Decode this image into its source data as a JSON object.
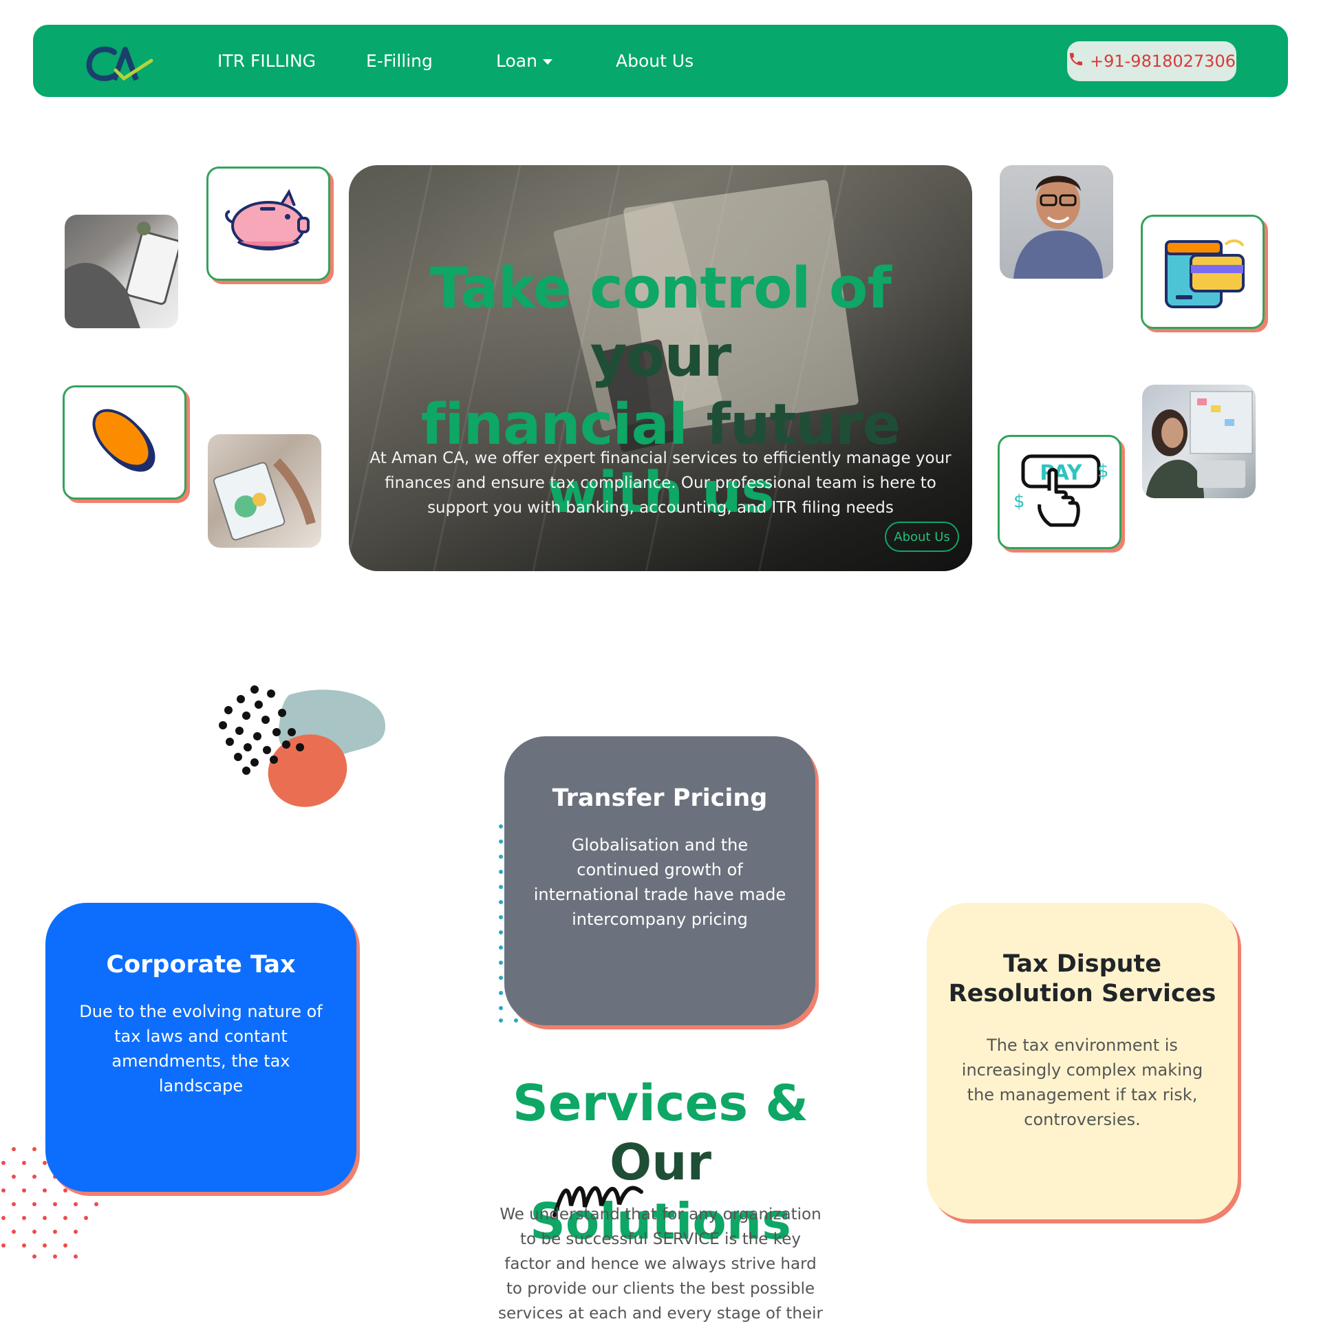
{
  "colors": {
    "brand_green": "#06a86b",
    "accent_coral": "#f0806e",
    "hero_title_green": "#0ea765",
    "hero_title_dark": "#1f4e36",
    "card_gray": "#6c727d",
    "card_blue": "#0d6efd",
    "card_cream": "#fff3cd"
  },
  "nav": {
    "logo_alt": "CA",
    "links": [
      {
        "label": "ITR FILLING"
      },
      {
        "label": "E-Filling"
      },
      {
        "label": "Loan"
      },
      {
        "label": "About Us"
      }
    ],
    "phone": "+91-9818027306",
    "phone_icon": "phone-icon"
  },
  "hero": {
    "title_part1": "Take control of ",
    "title_part2": "your",
    "title_part3": "financial ",
    "title_part4": "future",
    "title_part5": "with us",
    "description": "At Aman CA, we offer expert financial services to efficiently manage your finances and ensure tax compliance. Our professional team is here to support you with banking, accounting, and ITR filing needs",
    "button_label": "About Us"
  },
  "tiles": {
    "left_icons": [
      "piggy-bank-icon",
      "coin-icon"
    ],
    "right_icons": [
      "wallet-card-icon",
      "pay-click-icon"
    ],
    "pay_text": "PAY"
  },
  "services": {
    "cards": [
      {
        "title": "Transfer Pricing",
        "text": "Globalisation and the continued growth of international trade have made intercompany pricing"
      },
      {
        "title": "Corporate Tax",
        "text": "Due to the evolving nature of tax laws and contant amendments, the tax landscape"
      },
      {
        "title": "Tax Dispute Resolution Services",
        "text": "The tax environment is increasingly complex making the management if tax risk, controversies."
      }
    ],
    "heading_part1": "Services & ",
    "heading_part2": "Our",
    "heading_part3": "Solutions",
    "description": "We understand that for any organization to be successful SERVICE is the key factor and hence we always strive hard to provide our clients the best possible services at each and every stage of their"
  }
}
